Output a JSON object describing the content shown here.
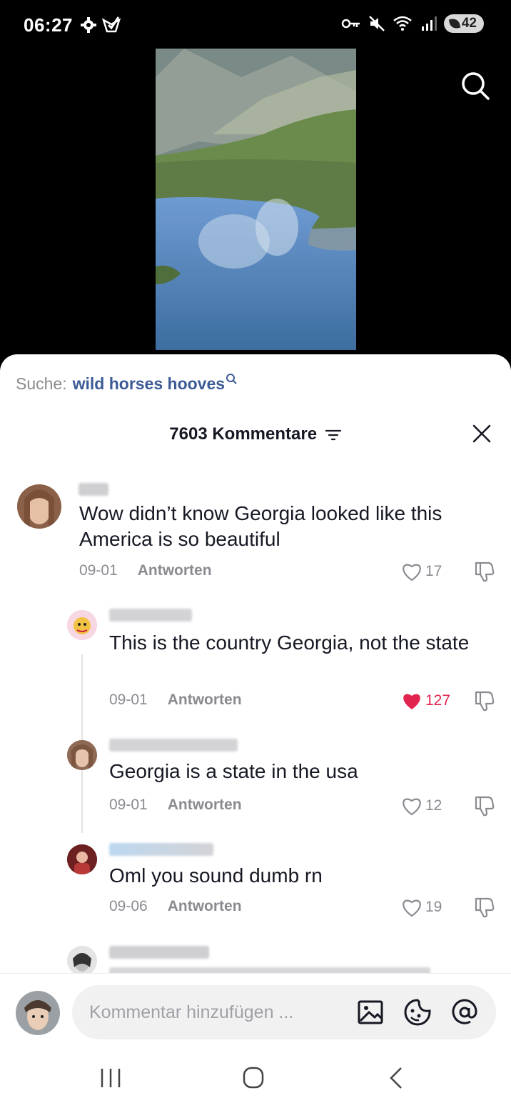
{
  "status_bar": {
    "time": "06:27",
    "battery": "42",
    "left_icons": [
      "gear-icon",
      "check-shield-icon"
    ],
    "right_icons": [
      "key-icon",
      "mute-icon",
      "wifi-icon",
      "signal-icon",
      "battery-icon"
    ]
  },
  "search_suggest": {
    "prefix": "Suche:",
    "query": "wild horses hooves"
  },
  "header": {
    "title": "7603 Kommentare"
  },
  "comments": [
    {
      "text": "Wow didn’t know Georgia looked like this America is so beautiful",
      "date": "09-01",
      "reply_label": "Antworten",
      "likes": "17",
      "liked": false
    },
    {
      "text": "This is the country Georgia, not the state",
      "date": "09-01",
      "reply_label": "Antworten",
      "likes": "127",
      "liked": true
    },
    {
      "text": "Georgia is a state in the usa",
      "date": "09-01",
      "reply_label": "Antworten",
      "likes": "12",
      "liked": false
    },
    {
      "text": "Oml you sound dumb rn",
      "date": "09-06",
      "reply_label": "Antworten",
      "likes": "19",
      "liked": false
    }
  ],
  "composer": {
    "placeholder": "Kommentar hinzufügen ..."
  },
  "colors": {
    "accent_like": "#e0244e",
    "link_blue": "#3c5a96",
    "muted": "#8a8b91"
  }
}
